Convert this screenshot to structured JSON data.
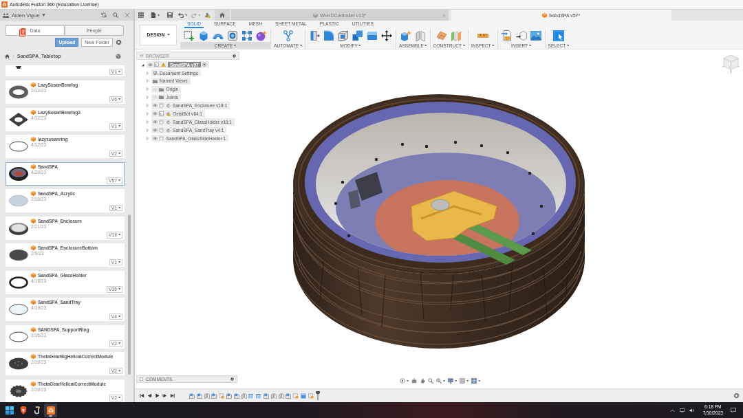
{
  "title_bar": {
    "title": "Autodesk Fusion 360 (Education License)"
  },
  "data_panel": {
    "user": "Aiden Vigue",
    "tabs": [
      {
        "label": "Data",
        "selected": true
      },
      {
        "label": "People",
        "selected": false
      }
    ],
    "actions": [
      {
        "label": "Upload",
        "kind": "primary"
      },
      {
        "label": "New Folder",
        "kind": "secondary"
      }
    ],
    "breadcrumb": "SandSPA_Tabletop",
    "files": [
      {
        "kind": "fragment",
        "version": "V1",
        "selected": false
      },
      {
        "kind": "thick-ring",
        "name": "LazySusanBearing",
        "date": "2/12/23",
        "version": "V6",
        "selected": false
      },
      {
        "kind": "square-plate",
        "name": "LazySusanBearing2",
        "date": "4/12/23",
        "version": "V1",
        "selected": false
      },
      {
        "kind": "thin-ring",
        "name": "lazysusanring",
        "date": "4/12/23",
        "version": "V2",
        "selected": false
      },
      {
        "kind": "bowl",
        "name": "SandSPA",
        "date": "4/29/23",
        "version": "V57",
        "selected": true
      },
      {
        "kind": "clear-disc",
        "name": "SandSPA_Acrylic",
        "date": "2/18/23",
        "version": "V1",
        "selected": false
      },
      {
        "kind": "open-bowl",
        "name": "SandSPA_Enclosure",
        "date": "2/21/23",
        "version": "V18",
        "selected": false
      },
      {
        "kind": "solid-disc",
        "name": "SandSPA_EnclosureBottom",
        "date": "2/9/23",
        "version": "V1",
        "selected": false
      },
      {
        "kind": "dark-ring",
        "name": "SandSPA_GlassHolder",
        "date": "4/18/23",
        "version": "V16",
        "selected": false
      },
      {
        "kind": "clear-ring",
        "name": "SandSPA_SandTray",
        "date": "4/19/23",
        "version": "V4",
        "selected": false
      },
      {
        "kind": "thin-ring",
        "name": "SANDSPA_SupportRing",
        "date": "2/16/23",
        "version": "V2",
        "selected": false
      },
      {
        "kind": "gear-disc",
        "name": "ThetaGearBigHelicalCorrectModule",
        "date": "2/28/23",
        "version": "V2",
        "selected": false
      },
      {
        "kind": "gear",
        "name": "ThetaGearHelicalCorrectModule",
        "date": "2/28/23",
        "version": "V2",
        "selected": false
      }
    ]
  },
  "document_tabs": [
    {
      "label": "WLEDController v13*",
      "selected": false
    },
    {
      "label": "SandSPA v57*",
      "selected": true
    }
  ],
  "toolbar": {
    "workspace": "DESIGN",
    "tabs": [
      {
        "label": "SOLID",
        "selected": true
      },
      {
        "label": "SURFACE",
        "selected": false
      },
      {
        "label": "MESH",
        "selected": false
      },
      {
        "label": "SHEET METAL",
        "selected": false
      },
      {
        "label": "PLASTIC",
        "selected": false
      },
      {
        "label": "UTILITIES",
        "selected": false
      }
    ],
    "groups": [
      {
        "label": "CREATE",
        "highlighted": true
      },
      {
        "label": "AUTOMATE",
        "highlighted": false
      },
      {
        "label": "MODIFY",
        "highlighted": false
      },
      {
        "label": "ASSEMBLE",
        "highlighted": false
      },
      {
        "label": "CONSTRUCT",
        "highlighted": false
      },
      {
        "label": "INSPECT",
        "highlighted": false
      },
      {
        "label": "INSERT",
        "highlighted": false
      },
      {
        "label": "SELECT",
        "highlighted": false
      }
    ]
  },
  "browser": {
    "title": "BROWSER",
    "root": {
      "label": "SandSPA v57",
      "expanded": true,
      "visible": true,
      "warning": true,
      "active": true,
      "children": [
        {
          "kind": "settings",
          "label": "Document Settings",
          "expanded": false
        },
        {
          "kind": "folder",
          "label": "Named Views",
          "expanded": false
        },
        {
          "kind": "folder",
          "label": "Origin",
          "expanded": false,
          "visible": false
        },
        {
          "kind": "folder",
          "label": "Joints",
          "expanded": false,
          "visible": false
        },
        {
          "kind": "body",
          "label": "SandSPA_Enclosure v18:1",
          "expanded": false,
          "visible": true,
          "linked": true,
          "warning": false
        },
        {
          "kind": "assembly",
          "label": "GeistBot v64:1",
          "expanded": false,
          "visible": true,
          "linked": true,
          "warning": true
        },
        {
          "kind": "body",
          "label": "SandSPA_GlassHolder v16:1",
          "expanded": false,
          "visible": true,
          "linked": true,
          "warning": false
        },
        {
          "kind": "body",
          "label": "SandSPA_SandTray v4:1",
          "expanded": false,
          "visible": true,
          "linked": true,
          "warning": false
        },
        {
          "kind": "body",
          "label": "SandSPA_GlassSideHolder:1",
          "expanded": false,
          "visible": true,
          "linked": false,
          "warning": false
        }
      ]
    }
  },
  "comments": {
    "title": "COMMENTS"
  },
  "taskbar": {
    "apps": [
      {
        "selected": false
      },
      {
        "selected": false
      },
      {
        "selected": true
      }
    ],
    "time": "6:18 PM",
    "date": "7/10/2023"
  }
}
